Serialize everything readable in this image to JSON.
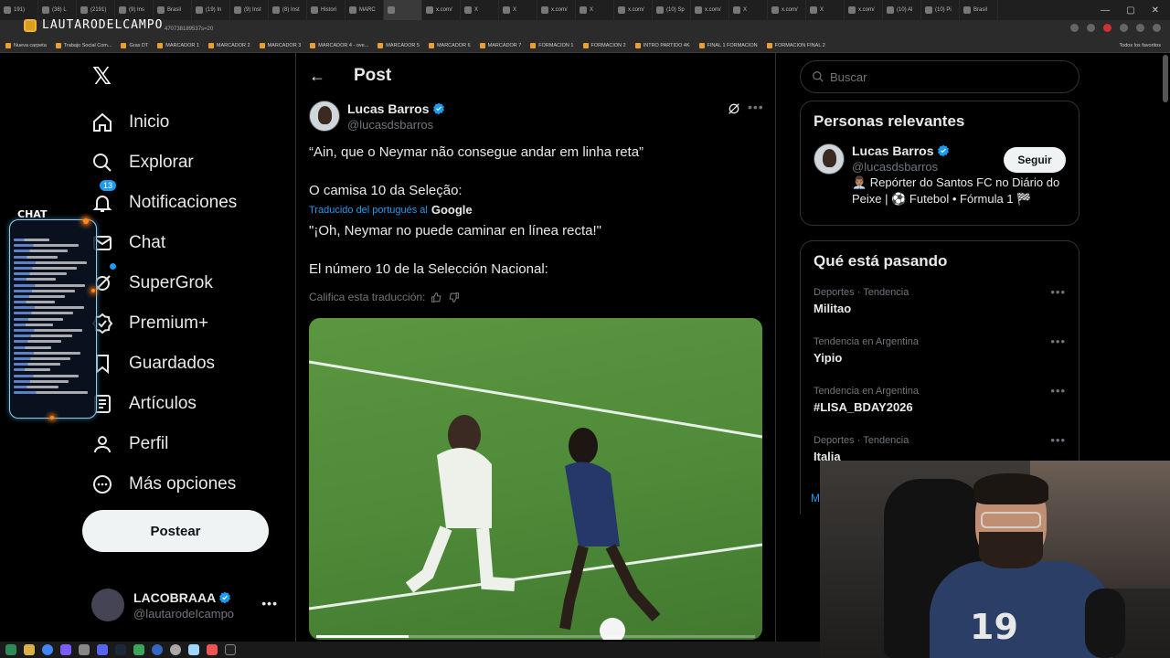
{
  "browser": {
    "tabs": [
      "191)",
      "(38) L",
      "(2191)",
      "(9) Ins",
      "Brasil",
      "(19) In",
      "(9) Inst",
      "(8) Inst",
      "Histori",
      "MARC",
      "",
      "x.com/",
      "X",
      "X",
      "x.com/",
      "X",
      "x.com/",
      "(10) Sp",
      "x.com/",
      "X",
      "x.com/",
      "X",
      "x.com/",
      "(10) Al",
      "(10) Pi",
      "Brasil"
    ],
    "url_fragment": "470738189537s=20",
    "bookmarks": [
      "Nueva carpeta",
      "Trabajo Social Com...",
      "Gras DT",
      "MARCADOR 1",
      "MARCADOR 2",
      "MARCADOR 3",
      "MARCADOR 4 - ove...",
      "MARCADOR 5",
      "MARCADOR 6",
      "MARCADOR 7",
      "FORMACION 1",
      "FORMACION 2",
      "INTRO PARTIDO 4K",
      "FINAL 1 FORMACION",
      "FORMACION FINAL 2"
    ],
    "bookmarks_right": "Todos los favoritos"
  },
  "overlay": {
    "streamer_logo": "LAUTARODELCAMPO",
    "chat_title": "CHAT"
  },
  "nav": {
    "items": [
      {
        "label": "Inicio",
        "icon": "home-icon"
      },
      {
        "label": "Explorar",
        "icon": "search-icon"
      },
      {
        "label": "Notificaciones",
        "icon": "bell-icon",
        "badge": "13"
      },
      {
        "label": "Chat",
        "icon": "mail-icon"
      },
      {
        "label": "SuperGrok",
        "icon": "grok-icon"
      },
      {
        "label": "Premium+",
        "icon": "verified-icon"
      },
      {
        "label": "Guardados",
        "icon": "bookmark-icon"
      },
      {
        "label": "Artículos",
        "icon": "article-icon"
      },
      {
        "label": "Perfil",
        "icon": "person-icon"
      },
      {
        "label": "Más opciones",
        "icon": "more-circle-icon"
      }
    ],
    "post_button": "Postear",
    "account": {
      "name": "LACOBRAAA",
      "handle": "@lautarodeIcampo"
    }
  },
  "post": {
    "header": "Post",
    "author_name": "Lucas Barros",
    "author_handle": "@lucasdsbarros",
    "text_original_1": "“Ain, que o Neymar não consegue andar em linha reta”",
    "text_original_2": "O camisa 10 da Seleção:",
    "translated_from": "Traducido del portugués al",
    "translator": "Google",
    "text_translated_1": "\"¡Oh, Neymar no puede caminar en línea recta!\"",
    "text_translated_2": "El número 10 de la Selección Nacional:",
    "rate_translation": "Califica esta traducción:",
    "video_progress": 0.21
  },
  "right": {
    "search_placeholder": "Buscar",
    "relevant_title": "Personas relevantes",
    "relevant_person": {
      "name": "Lucas Barros",
      "handle": "@lucasdsbarros",
      "follow": "Seguir",
      "bio": "👨🏽‍💼 Repórter do Santos FC no Diário do Peixe | ⚽ Futebol • Fórmula 1 🏁"
    },
    "trends_title": "Qué está pasando",
    "trends": [
      {
        "meta": "Deportes · Tendencia",
        "name": "Militao"
      },
      {
        "meta": "Tendencia en Argentina",
        "name": "Yipio"
      },
      {
        "meta": "Tendencia en Argentina",
        "name": "#LISA_BDAY2026"
      },
      {
        "meta": "Deportes · Tendencia",
        "name": "Italia"
      }
    ],
    "show_more_fragment": "M"
  },
  "webcam": {
    "jersey_number": "19"
  },
  "colors": {
    "accent": "#1d9bf0",
    "background": "#000000",
    "border": "#2f3336",
    "muted": "#71767b"
  }
}
